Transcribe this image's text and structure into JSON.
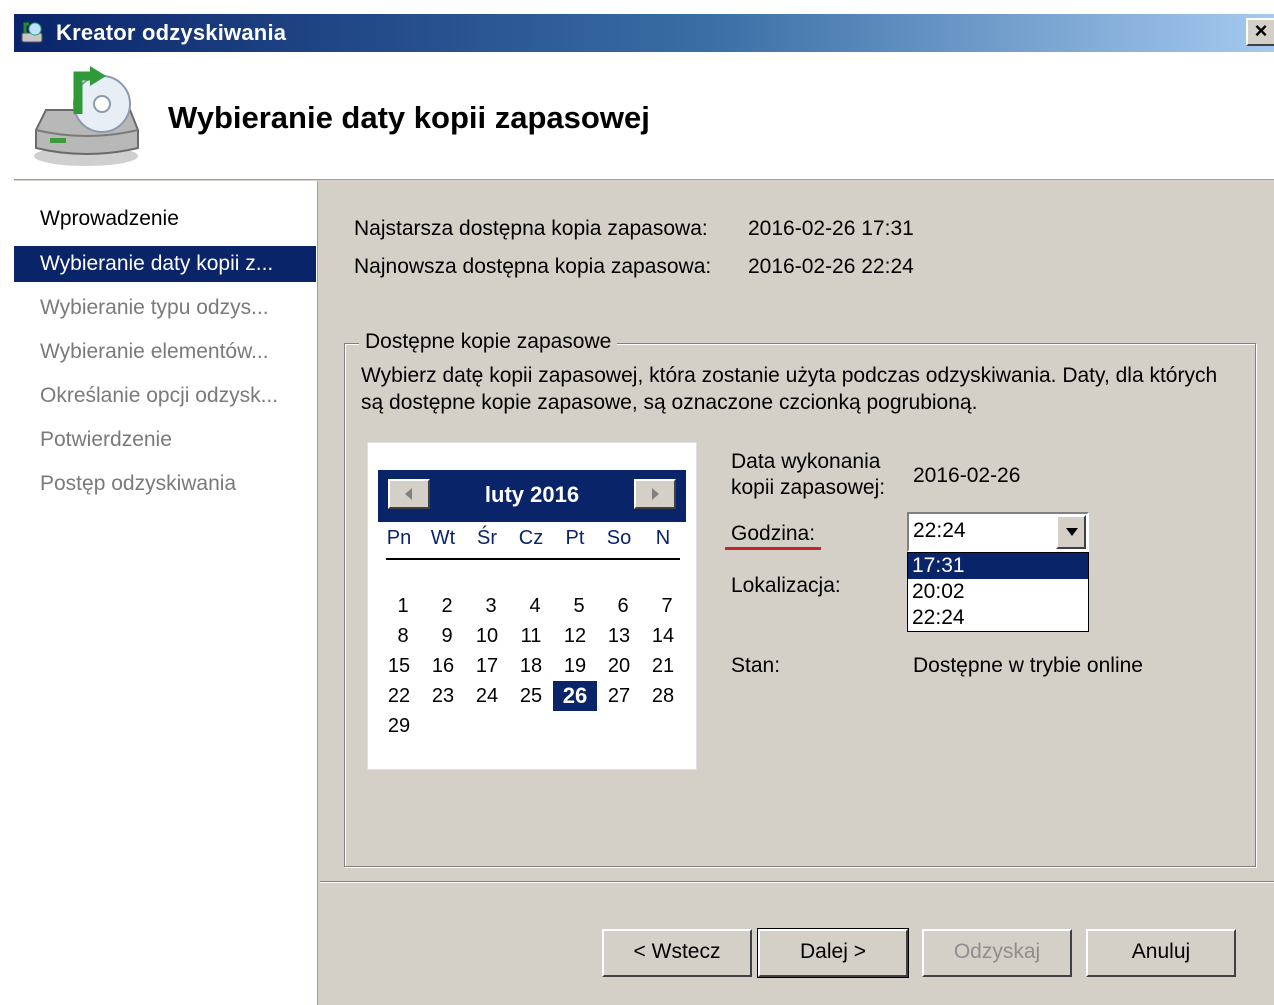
{
  "window": {
    "title": "Kreator odzyskiwania",
    "close_glyph": "×"
  },
  "header": {
    "title": "Wybieranie daty kopii zapasowej"
  },
  "sidebar": {
    "items": [
      {
        "label": "Wprowadzenie",
        "state": "done"
      },
      {
        "label": "Wybieranie daty kopii z...",
        "state": "active"
      },
      {
        "label": "Wybieranie typu odzys...",
        "state": "pending"
      },
      {
        "label": "Wybieranie elementów...",
        "state": "pending"
      },
      {
        "label": "Określanie opcji odzysk...",
        "state": "pending"
      },
      {
        "label": "Potwierdzenie",
        "state": "pending"
      },
      {
        "label": "Postęp odzyskiwania",
        "state": "pending"
      }
    ]
  },
  "info": {
    "oldest_label": "Najstarsza dostępna kopia zapasowa:",
    "oldest_value": "2016-02-26 17:31",
    "newest_label": "Najnowsza dostępna kopia zapasowa:",
    "newest_value": "2016-02-26 22:24"
  },
  "group": {
    "legend": "Dostępne kopie zapasowe",
    "description": "Wybierz datę kopii zapasowej, która zostanie użyta podczas odzyskiwania. Daty, dla których są dostępne kopie zapasowe, są oznaczone czcionką pogrubioną."
  },
  "calendar": {
    "month_title": "luty 2016",
    "weekdays": [
      "Pn",
      "Wt",
      "Śr",
      "Cz",
      "Pt",
      "So",
      "N"
    ],
    "days": [
      "1",
      "2",
      "3",
      "4",
      "5",
      "6",
      "7",
      "8",
      "9",
      "10",
      "11",
      "12",
      "13",
      "14",
      "15",
      "16",
      "17",
      "18",
      "19",
      "20",
      "21",
      "22",
      "23",
      "24",
      "25",
      "26",
      "27",
      "28",
      "29"
    ],
    "selected_day": "26"
  },
  "details": {
    "date_label_line1": "Data wykonania",
    "date_label_line2": "kopii zapasowej:",
    "date_value": "2016-02-26",
    "time_label": "Godzina:",
    "time_value": "22:24",
    "time_options": [
      "17:31",
      "20:02",
      "22:24"
    ],
    "time_highlighted": "17:31",
    "location_label": "Lokalizacja:",
    "status_label": "Stan:",
    "status_value": "Dostępne w trybie online"
  },
  "buttons": {
    "back": "< Wstecz",
    "next": "Dalej >",
    "recover": "Odzyskaj",
    "cancel": "Anuluj"
  },
  "colors": {
    "accent": "#0a246a",
    "underline": "#c0262c",
    "face": "#d4d0c8"
  }
}
